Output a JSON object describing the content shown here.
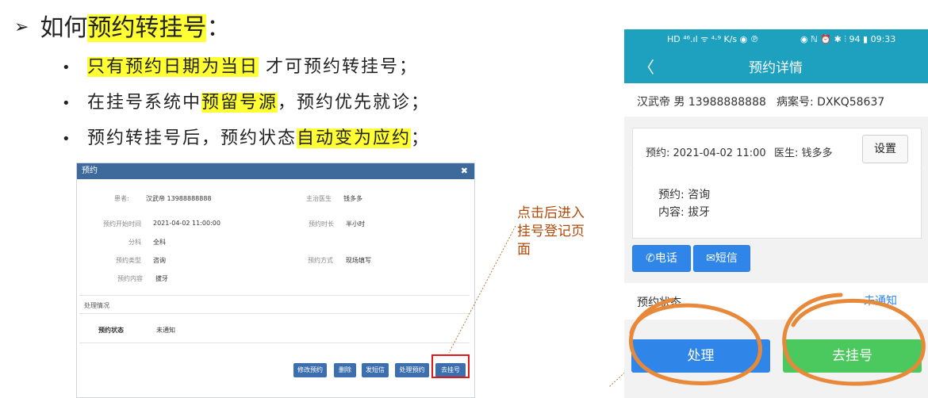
{
  "slide": {
    "title_prefix": "如何",
    "title_highlight": "预约转挂号",
    "title_suffix": "：",
    "bullet1_highlight": "只有预约日期为当日",
    "bullet1_rest": " 才可预约转挂号；",
    "bullet2_pre": "在挂号系统中",
    "bullet2_highlight": "预留号源",
    "bullet2_rest": "，预约优先就诊；",
    "bullet3_pre": "预约转挂号后，预约状态",
    "bullet3_highlight": "自动变为应约",
    "bullet3_rest": "；",
    "bullet_dot": "•",
    "arrow": "➢"
  },
  "dialog": {
    "title": "预约",
    "close": "✖",
    "patient_label": "患者:",
    "patient_value": "汉武帝 13988888888",
    "doctor_label": "主治医生",
    "doctor_value": "钱多多",
    "start_label": "预约开始时间",
    "start_value": "2021-04-02 11:00:00",
    "duration_label": "预约时长",
    "duration_value": "半小时",
    "dept_label": "分科",
    "dept_value": "全科",
    "type_label": "预约类型",
    "type_value": "咨询",
    "method_label": "预约方式",
    "method_value": "现场填写",
    "content_label": "预约内容",
    "content_value": "拔牙",
    "section_title": "处理情况",
    "status_label": "预约状态",
    "status_value": "未通知",
    "buttons": [
      "修改预约",
      "删除",
      "发短信",
      "处理预约",
      "去挂号"
    ]
  },
  "annotation": {
    "line1": "点击后进入",
    "line2": "挂号登记页",
    "line3": "面"
  },
  "phone": {
    "status_left": "HD ⁴⁶.ıl  ᯤ ⁴·⁹ K/s  ◉ ℗",
    "status_right": "◉ ℕ ⏰ ✱ ⫶ 94 ▮ 09:33",
    "back": "〈",
    "nav_title": "预约详情",
    "patient_line": "汉武帝 男 13988888888",
    "record_label": "病案号: DXKQ58637",
    "appt_time": "预约: 2021-04-02 11:00",
    "doctor": "医生: 钱多多",
    "settings": "设置",
    "appt_type": "预约: 咨询",
    "appt_content": "内容: 拔牙",
    "phone_btn": "电话",
    "sms_btn": "短信",
    "status_label": "预约状态",
    "status_value": "未通知",
    "process_btn": "处理",
    "register_btn": "去挂号"
  },
  "colors": {
    "highlight": "#ffff33",
    "dialog_header": "#3d6a9a",
    "phone_header": "#1ea0bf",
    "primary_blue": "#2f86e8",
    "green": "#4cc95e",
    "circle_orange": "#e8893a",
    "red_box": "#e01818"
  }
}
